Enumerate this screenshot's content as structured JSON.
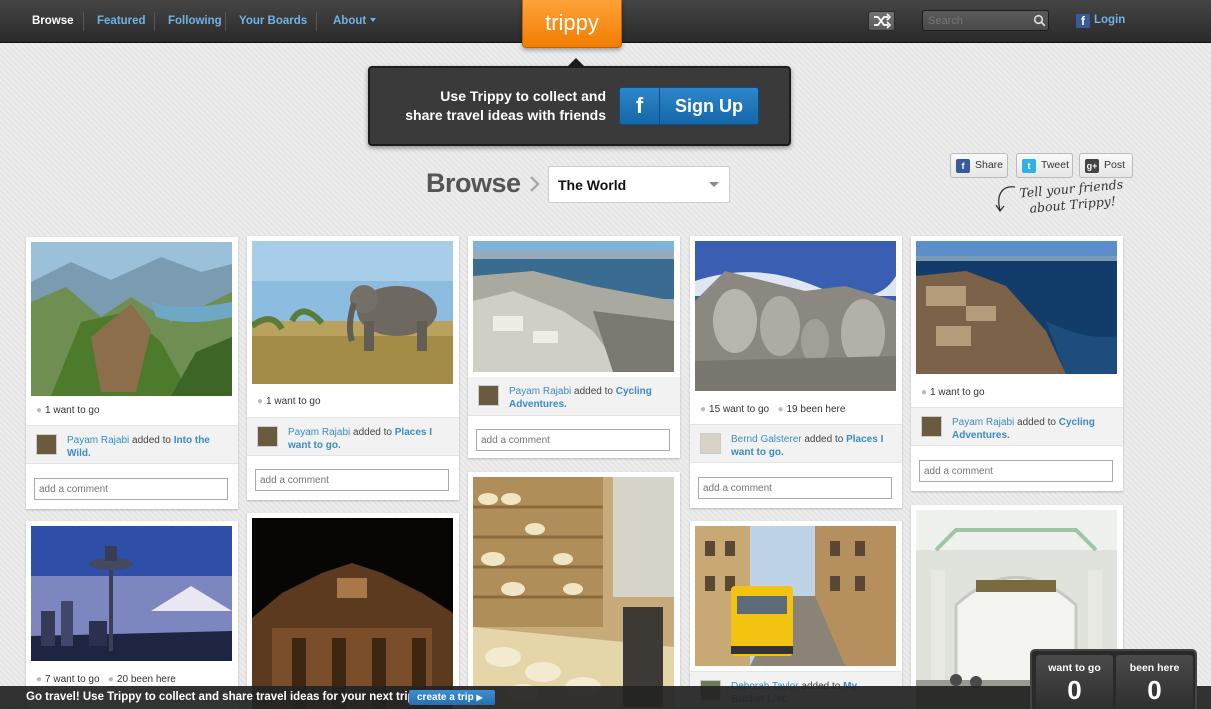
{
  "nav": {
    "items": [
      {
        "label": "Browse",
        "active": true
      },
      {
        "label": "Featured"
      },
      {
        "label": "Following"
      },
      {
        "label": "Your Boards"
      },
      {
        "label": "About"
      }
    ],
    "logo": "trippy",
    "search_placeholder": "Search",
    "login": "Login"
  },
  "signup": {
    "text_line1": "Use Trippy to collect and",
    "text_line2": "share travel ideas with friends",
    "button": "Sign Up",
    "fb_icon": "f"
  },
  "browse": {
    "title": "Browse",
    "selected": "The World"
  },
  "share": {
    "facebook": "Share",
    "twitter": "Tweet",
    "google": "Post",
    "tell_line1": "Tell your friends",
    "tell_line2": "about Trippy!"
  },
  "pins": [
    {
      "stat1": "1 want to go",
      "user": "Payam Rajabi",
      "verb": "added to",
      "board": "Into the Wild.",
      "comment_placeholder": "add a comment",
      "image": "canyon-landscape"
    },
    {
      "stat1": "1 want to go",
      "user": "Payam Rajabi",
      "verb": "added to",
      "board": "Places I want to go.",
      "comment_placeholder": "add a comment",
      "image": "elephant-savanna"
    },
    {
      "user": "Payam Rajabi",
      "verb": "added to",
      "board": "Cycling Adventures.",
      "comment_placeholder": "add a comment",
      "image": "rocky-coast"
    },
    {
      "stat1": "15 want to go",
      "stat2": "19 been here",
      "user": "Bernd Galsterer",
      "verb": "added to",
      "board": "Places I want to go.",
      "comment_placeholder": "add a comment",
      "image": "mount-rushmore"
    },
    {
      "stat1": "1 want to go",
      "user": "Payam Rajabi",
      "verb": "added to",
      "board": "Cycling Adventures.",
      "comment_placeholder": "add a comment",
      "image": "ruins-coast"
    },
    {
      "stat1": "7 want to go",
      "stat2": "20 been here",
      "image": "space-needle"
    },
    {
      "image": "trevi-night"
    },
    {
      "image": "cheese-shop"
    },
    {
      "user": "Deborah Taylor",
      "verb": "added to",
      "board": "My Bucket List.",
      "image": "lisbon-tram"
    },
    {
      "image": "white-hall"
    }
  ],
  "bottom": {
    "text": "Go travel! Use Trippy to collect and share travel ideas for your next trip",
    "button": "create a trip"
  },
  "counters": {
    "want_label": "want to go",
    "want_value": "0",
    "been_label": "been here",
    "been_value": "0"
  }
}
